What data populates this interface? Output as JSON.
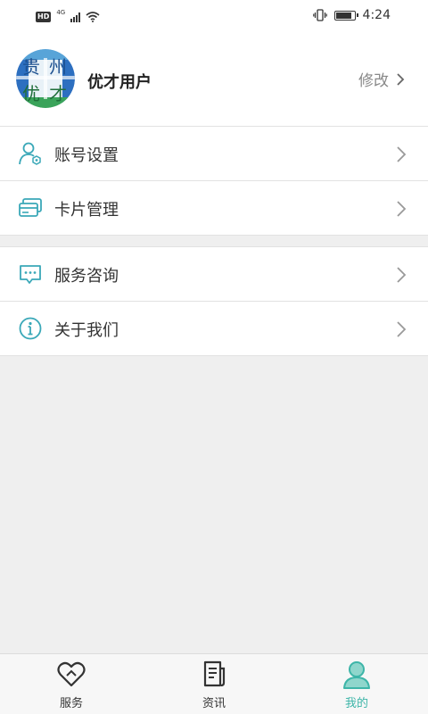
{
  "status_bar": {
    "network_badge": "HD",
    "network_type": "4G",
    "time": "4:24",
    "battery_level": 0.9
  },
  "profile": {
    "avatar_text": "贵州优才",
    "username": "优才用户",
    "edit_label": "修改"
  },
  "menu": {
    "group1": [
      {
        "label": "账号设置",
        "icon": "user-settings-icon"
      },
      {
        "label": "卡片管理",
        "icon": "card-icon"
      }
    ],
    "group2": [
      {
        "label": "服务咨询",
        "icon": "chat-icon"
      },
      {
        "label": "关于我们",
        "icon": "info-icon"
      }
    ]
  },
  "tabbar": {
    "tabs": [
      {
        "label": "服务",
        "icon": "heart-icon",
        "active": false
      },
      {
        "label": "资讯",
        "icon": "news-icon",
        "active": false
      },
      {
        "label": "我的",
        "icon": "person-icon",
        "active": true
      }
    ]
  },
  "colors": {
    "accent": "#3db5a8",
    "icon": "#3aa8b8",
    "text": "#333333",
    "muted": "#888888",
    "background": "#efefef"
  }
}
